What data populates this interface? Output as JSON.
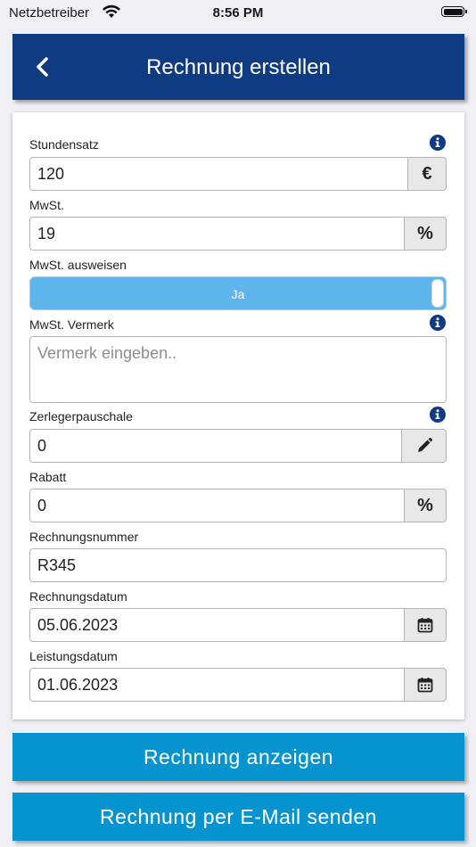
{
  "status_bar": {
    "carrier": "Netzbetreiber",
    "time": "8:56 PM"
  },
  "header": {
    "title": "Rechnung erstellen"
  },
  "form": {
    "stundensatz": {
      "label": "Stundensatz",
      "value": "120",
      "addon": "€"
    },
    "mwst": {
      "label": "MwSt.",
      "value": "19",
      "addon": "%"
    },
    "mwst_ausweisen": {
      "label": "MwSt. ausweisen",
      "value": "Ja"
    },
    "mwst_vermerk": {
      "label": "MwSt. Vermerk",
      "placeholder": "Vermerk eingeben.."
    },
    "zerlegerpauschale": {
      "label": "Zerlegerpauschale",
      "value": "0"
    },
    "rabatt": {
      "label": "Rabatt",
      "value": "0",
      "addon": "%"
    },
    "rechnungsnummer": {
      "label": "Rechnungsnummer",
      "value": "R345"
    },
    "rechnungsdatum": {
      "label": "Rechnungsdatum",
      "value": "05.06.2023"
    },
    "leistungsdatum": {
      "label": "Leistungsdatum",
      "value": "01.06.2023"
    }
  },
  "buttons": {
    "show_invoice": "Rechnung anzeigen",
    "send_email": "Rechnung per E-Mail senden"
  },
  "colors": {
    "header_bg": "#0f3b82",
    "button_bg": "#0594d0",
    "toggle_bg": "#5db5ec",
    "info_icon": "#0f3b82"
  },
  "icons": {
    "back": "chevron-left-icon",
    "info": "info-circle-icon",
    "edit": "pencil-icon",
    "calendar": "calendar-icon"
  }
}
